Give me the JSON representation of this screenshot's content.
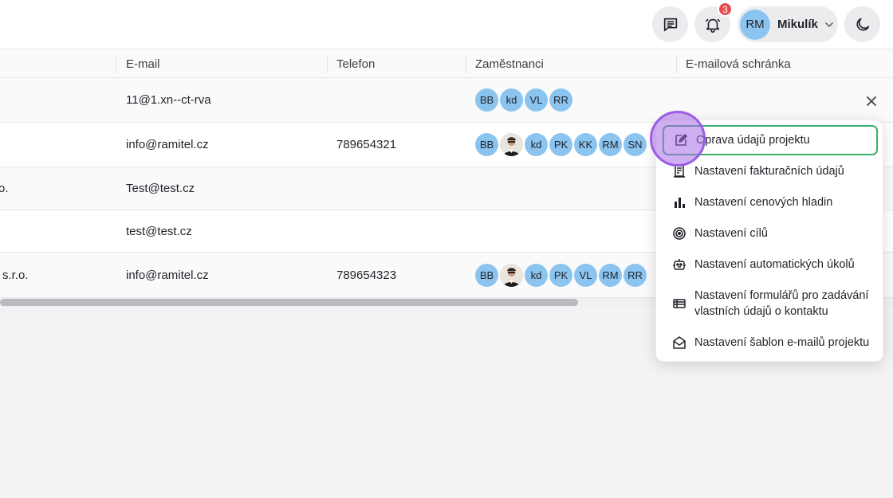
{
  "topbar": {
    "notifications_count": "3",
    "user_initials": "RM",
    "user_name": "Mikulík"
  },
  "table": {
    "columns": [
      "E-mail",
      "Telefon",
      "Zaměstnanci",
      "E-mailová schránka"
    ],
    "rows": [
      {
        "name": "",
        "email": "11@1.xn--ct-rva",
        "phone": "",
        "employees": [
          "BB",
          "kd",
          "VL",
          "RR"
        ]
      },
      {
        "name": "",
        "email": "info@ramitel.cz",
        "phone": "789654321",
        "employees": [
          "BB",
          "photo",
          "kd",
          "PK",
          "KK",
          "RM",
          "SN"
        ]
      },
      {
        "name": "o.",
        "email": "Test@test.cz",
        "phone": "",
        "employees": []
      },
      {
        "name": "",
        "email": "test@test.cz",
        "phone": "",
        "employees": []
      },
      {
        "name": "s.r.o.",
        "email": "info@ramitel.cz",
        "phone": "789654323",
        "employees": [
          "BB",
          "photo",
          "kd",
          "PK",
          "VL",
          "RM",
          "RR"
        ]
      }
    ]
  },
  "menu": {
    "items": [
      {
        "label": "Oprava údajů projektu",
        "icon": "edit-icon"
      },
      {
        "label": "Nastavení fakturačních údajů",
        "icon": "invoice-icon"
      },
      {
        "label": "Nastavení cenových hladin",
        "icon": "bar-chart-icon"
      },
      {
        "label": "Nastavení cílů",
        "icon": "target-icon"
      },
      {
        "label": "Nastavení automatických úkolů",
        "icon": "robot-icon"
      },
      {
        "label": "Nastavení formulářů pro zadávání vlastních údajů o kontaktu",
        "icon": "form-list-icon"
      },
      {
        "label": "Nastavení šablon e-mailů projektu",
        "icon": "envelope-open-icon"
      }
    ]
  },
  "colors": {
    "avatar": "#8cc4f0",
    "badge": "#e5484d",
    "active_border": "#3ab06a",
    "pointer": "#9b5de5"
  }
}
